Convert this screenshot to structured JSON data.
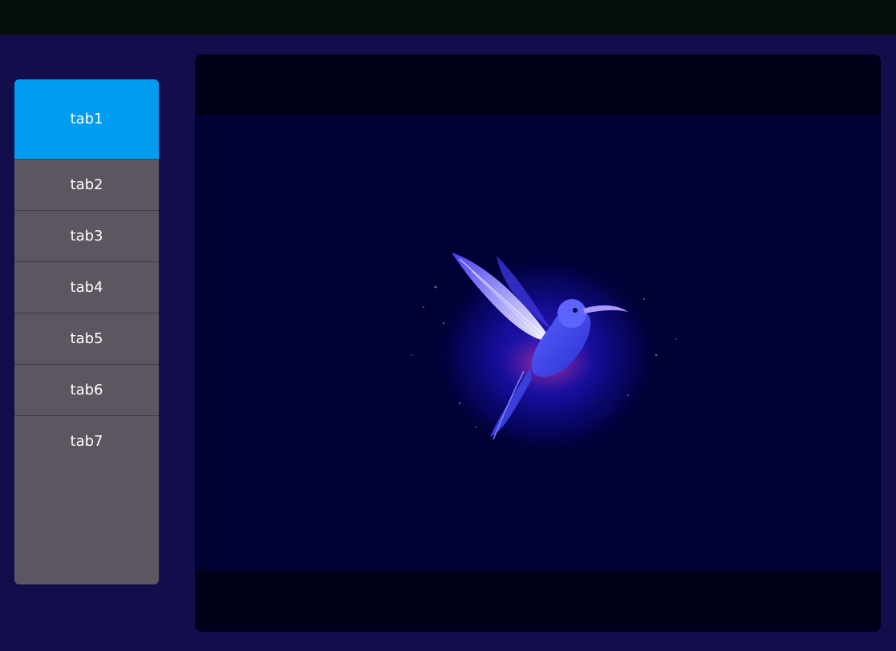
{
  "tabs": [
    {
      "label": "tab1",
      "active": true
    },
    {
      "label": "tab2",
      "active": false
    },
    {
      "label": "tab3",
      "active": false
    },
    {
      "label": "tab4",
      "active": false
    },
    {
      "label": "tab5",
      "active": false
    },
    {
      "label": "tab6",
      "active": false
    },
    {
      "label": "tab7",
      "active": false
    }
  ],
  "image": {
    "icon": "hummingbird-illustration"
  },
  "colors": {
    "page_bg": "#110e4b",
    "topbar_bg": "#070f0e",
    "tab_bg": "#5d5661",
    "tab_active_bg": "#009cf0",
    "viewer_bg": "#00001a",
    "art_bg": "#000034"
  }
}
